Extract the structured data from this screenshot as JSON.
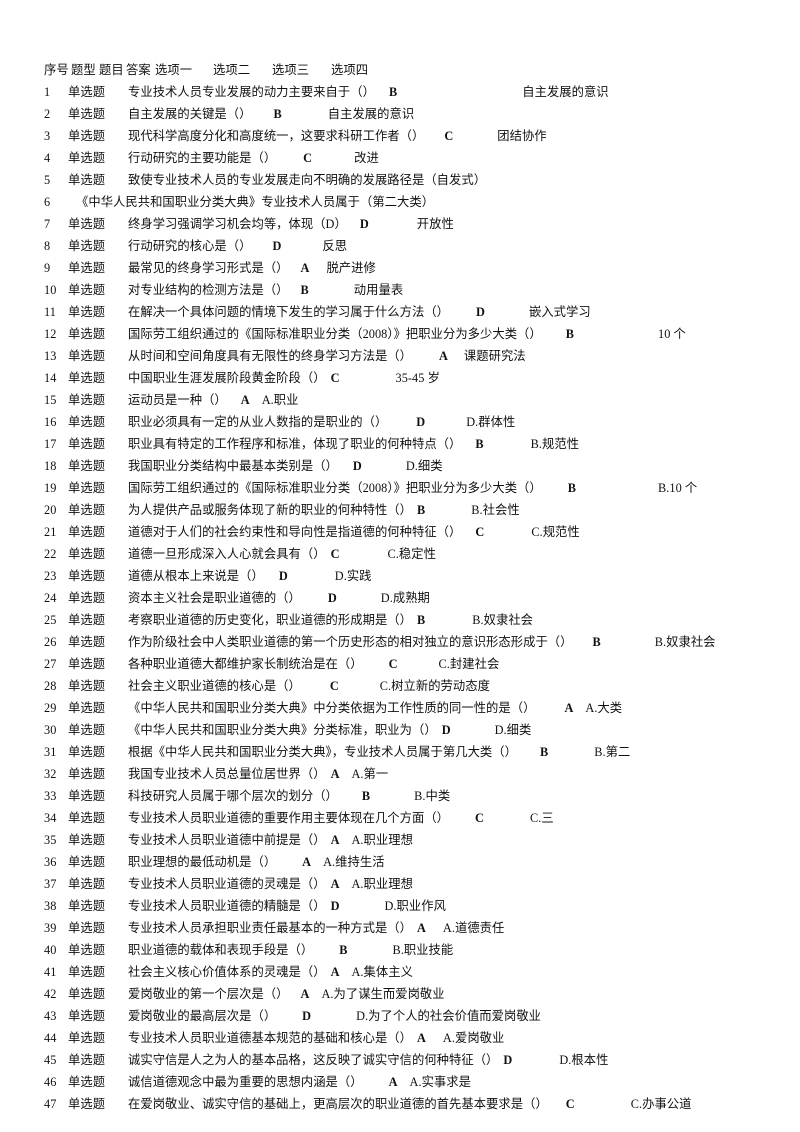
{
  "document": {
    "kind": "tab-delimited-question-bank",
    "header": {
      "seq": "序号",
      "type": "题型",
      "question": "题目",
      "answer": "答案",
      "option1": "选项一",
      "option2": "选项二",
      "option3": "选项三",
      "option4": "选项四"
    },
    "rows": [
      {
        "seq": "1",
        "type": "单选题",
        "question": "专业技术人员专业发展的动力主要来自于（）",
        "answer": "B",
        "option": "自主发展的意识",
        "gap_q": 14,
        "gap_a": 125
      },
      {
        "seq": "2",
        "type": "单选题",
        "question": "自主发展的关键是（）",
        "answer": "B",
        "option": "自主发展的意识",
        "gap_q": 22,
        "gap_a": 46
      },
      {
        "seq": "3",
        "type": "单选题",
        "question": "现代科学高度分化和高度统一，这要求科研工作者（）",
        "answer": "C",
        "option": "团结协作",
        "gap_q": 20,
        "gap_a": 44
      },
      {
        "seq": "4",
        "type": "单选题",
        "question": "行动研究的主要功能是（）",
        "answer": "C",
        "option": "改进",
        "gap_q": 27,
        "gap_a": 42
      },
      {
        "seq": "5",
        "type": "单选题",
        "question": "致使专业技术人员的专业发展走向不明确的发展路径是（自发式）",
        "answer": "",
        "option": "",
        "gap_q": 0,
        "gap_a": 0
      },
      {
        "seq": "6",
        "type": "",
        "question": "《中华人民共和国职业分类大典》专业技术人员属于（第二大类）",
        "answer": "",
        "option": "",
        "gap_q": 0,
        "gap_a": 0
      },
      {
        "seq": "7",
        "type": "单选题",
        "question": "终身学习强调学习机会均等，体现（D）",
        "answer": "D",
        "option": "开放性",
        "gap_q": 13,
        "gap_a": 48
      },
      {
        "seq": "8",
        "type": "单选题",
        "question": "行动研究的核心是（）",
        "answer": "D",
        "option": "反思",
        "gap_q": 21,
        "gap_a": 41
      },
      {
        "seq": "9",
        "type": "单选题",
        "question": "最常见的终身学习形式是（）",
        "answer": "A",
        "option": "脱产进修",
        "gap_q": 12,
        "gap_a": 17
      },
      {
        "seq": "10",
        "type": "单选题",
        "question": "对专业结构的检测方法是（）",
        "answer": "B",
        "option": "动用量表",
        "gap_q": 12,
        "gap_a": 45
      },
      {
        "seq": "11",
        "type": "单选题",
        "question": "在解决一个具体问题的情境下发生的学习属于什么方法（）",
        "answer": "D",
        "option": "嵌入式学习",
        "gap_q": 27,
        "gap_a": 44
      },
      {
        "seq": "12",
        "type": "单选题",
        "question": "国际劳工组织通过的《国际标准职业分类（2008）》把职业分为多少大类（）",
        "answer": "B",
        "option": "10 个",
        "gap_q": 24,
        "gap_a": 84
      },
      {
        "seq": "13",
        "type": "单选题",
        "question": "从时间和空间角度具有无限性的终身学习方法是（）",
        "answer": "A",
        "option": "课题研究法",
        "gap_q": 27,
        "gap_a": 16
      },
      {
        "seq": "14",
        "type": "单选题",
        "question": "中国职业生涯发展阶段黄金阶段（）",
        "answer": "C",
        "option": "35-45 岁",
        "gap_q": 5,
        "gap_a": 56
      },
      {
        "seq": "15",
        "type": "单选题",
        "question": "运动员是一种（）",
        "answer": "A",
        "option": "A.职业",
        "gap_q": 14,
        "gap_a": 12
      },
      {
        "seq": "16",
        "type": "单选题",
        "question": "职业必须具有一定的从业人数指的是职业的（）",
        "answer": "D",
        "option": "D.群体性",
        "gap_q": 29,
        "gap_a": 41
      },
      {
        "seq": "17",
        "type": "单选题",
        "question": "职业具有特定的工作程序和标准，体现了职业的何种特点（）",
        "answer": "B",
        "option": "B.规范性",
        "gap_q": 14,
        "gap_a": 47
      },
      {
        "seq": "18",
        "type": "单选题",
        "question": "我国职业分类结构中最基本类别是（）",
        "answer": "D",
        "option": "D.细类",
        "gap_q": 15,
        "gap_a": 44
      },
      {
        "seq": "19",
        "type": "单选题",
        "question": "国际劳工组织通过的《国际标准职业分类（2008）》把职业分为多少大类（）",
        "answer": "B",
        "option": "B.10 个",
        "gap_q": 26,
        "gap_a": 82
      },
      {
        "seq": "20",
        "type": "单选题",
        "question": "为人提供产品或服务体现了新的职业的何种特性（）",
        "answer": "B",
        "option": "B.社会性",
        "gap_q": 5,
        "gap_a": 46
      },
      {
        "seq": "21",
        "type": "单选题",
        "question": "道德对于人们的社会约束性和导向性是指道德的何种特征（）",
        "answer": "C",
        "option": "C.规范性",
        "gap_q": 14,
        "gap_a": 47
      },
      {
        "seq": "22",
        "type": "单选题",
        "question": "道德一旦形成深入人心就会具有（）",
        "answer": "C",
        "option": "C.稳定性",
        "gap_q": 5,
        "gap_a": 48
      },
      {
        "seq": "23",
        "type": "单选题",
        "question": "道德从根本上来说是（）",
        "answer": "D",
        "option": "D.实践",
        "gap_q": 15,
        "gap_a": 47
      },
      {
        "seq": "24",
        "type": "单选题",
        "question": "资本主义社会是职业道德的（）",
        "answer": "D",
        "option": "D.成熟期",
        "gap_q": 27,
        "gap_a": 44
      },
      {
        "seq": "25",
        "type": "单选题",
        "question": "考察职业道德的历史变化，职业道德的形成期是（）",
        "answer": "B",
        "option": "B.奴隶社会",
        "gap_q": 5,
        "gap_a": 47
      },
      {
        "seq": "26",
        "type": "单选题",
        "question": "作为阶级社会中人类职业道德的第一个历史形态的相对独立的意识形态形成于（）",
        "answer": "B",
        "option": "B.奴隶社会",
        "gap_q": 20,
        "gap_a": 54
      },
      {
        "seq": "27",
        "type": "单选题",
        "question": "各种职业道德大都维护家长制统治是在（）",
        "answer": "C",
        "option": "C.封建社会",
        "gap_q": 26,
        "gap_a": 41
      },
      {
        "seq": "28",
        "type": "单选题",
        "question": "社会主义职业道德的核心是（）",
        "answer": "C",
        "option": "C.树立新的劳动态度",
        "gap_q": 29,
        "gap_a": 41
      },
      {
        "seq": "29",
        "type": "单选题",
        "question": "《中华人民共和国职业分类大典》中分类依据为工作性质的同一性的是（）",
        "answer": "A",
        "option": "A.大类",
        "gap_q": 29,
        "gap_a": 12
      },
      {
        "seq": "30",
        "type": "单选题",
        "question": "《中华人民共和国职业分类大典》分类标准，职业为（）",
        "answer": "D",
        "option": "D.细类",
        "gap_q": 5,
        "gap_a": 44
      },
      {
        "seq": "31",
        "type": "单选题",
        "question": "根据《中华人民共和国职业分类大典》，专业技术人员属于第几大类（）",
        "answer": "B",
        "option": "B.第二",
        "gap_q": 23,
        "gap_a": 46
      },
      {
        "seq": "32",
        "type": "单选题",
        "question": "我国专业技术人员总量位居世界（）",
        "answer": "A",
        "option": "A.第一",
        "gap_q": 5,
        "gap_a": 12
      },
      {
        "seq": "33",
        "type": "单选题",
        "question": "科技研究人员属于哪个层次的划分（）",
        "answer": "B",
        "option": "B.中类",
        "gap_q": 24,
        "gap_a": 44
      },
      {
        "seq": "34",
        "type": "单选题",
        "question": "专业技术人员职业道德的重要作用主要体现在几个方面（）",
        "answer": "C",
        "option": "C.三",
        "gap_q": 26,
        "gap_a": 46
      },
      {
        "seq": "35",
        "type": "单选题",
        "question": "专业技术人员职业道德中前提是（）",
        "answer": "A",
        "option": "A.职业理想",
        "gap_q": 5,
        "gap_a": 12
      },
      {
        "seq": "36",
        "type": "单选题",
        "question": "职业理想的最低动机是（）",
        "answer": "A",
        "option": "A.维持生活",
        "gap_q": 26,
        "gap_a": 12
      },
      {
        "seq": "37",
        "type": "单选题",
        "question": "专业技术人员职业道德的灵魂是（）",
        "answer": "A",
        "option": "A.职业理想",
        "gap_q": 5,
        "gap_a": 12
      },
      {
        "seq": "38",
        "type": "单选题",
        "question": "专业技术人员职业道德的精髓是（）",
        "answer": "D",
        "option": "D.职业作风",
        "gap_q": 5,
        "gap_a": 45
      },
      {
        "seq": "39",
        "type": "单选题",
        "question": "专业技术人员承担职业责任最基本的一种方式是（）",
        "answer": "A",
        "option": "A.道德责任",
        "gap_q": 5,
        "gap_a": 17
      },
      {
        "seq": "40",
        "type": "单选题",
        "question": "职业道德的载体和表现手段是（）",
        "answer": "B",
        "option": "B.职业技能",
        "gap_q": 26,
        "gap_a": 45
      },
      {
        "seq": "41",
        "type": "单选题",
        "question": "社会主义核心价值体系的灵魂是（）",
        "answer": "A",
        "option": "A.集体主义",
        "gap_q": 5,
        "gap_a": 12
      },
      {
        "seq": "42",
        "type": "单选题",
        "question": "爱岗敬业的第一个层次是（）",
        "answer": "A",
        "option": "A.为了谋生而爱岗敬业",
        "gap_q": 12,
        "gap_a": 12
      },
      {
        "seq": "43",
        "type": "单选题",
        "question": "爱岗敬业的最高层次是（）",
        "answer": "D",
        "option": "D.为了个人的社会价值而爱岗敬业",
        "gap_q": 26,
        "gap_a": 45
      },
      {
        "seq": "44",
        "type": "单选题",
        "question": "专业技术人员职业道德基本规范的基础和核心是（）",
        "answer": "A",
        "option": "A.爱岗敬业",
        "gap_q": 5,
        "gap_a": 17
      },
      {
        "seq": "45",
        "type": "单选题",
        "question": "诚实守信是人之为人的基本品格，这反映了诚实守信的何种特征（）",
        "answer": "D",
        "option": "D.根本性",
        "gap_q": 5,
        "gap_a": 47
      },
      {
        "seq": "46",
        "type": "单选题",
        "question": "诚信道德观念中最为重要的思想内涵是（）",
        "answer": "A",
        "option": "A.实事求是",
        "gap_q": 26,
        "gap_a": 12
      },
      {
        "seq": "47",
        "type": "单选题",
        "question": "在爱岗敬业、诚实守信的基础上，更高层次的职业道德的首先基本要求是（）",
        "answer": "C",
        "option": "C.办事公道",
        "gap_q": 18,
        "gap_a": 56
      }
    ]
  }
}
